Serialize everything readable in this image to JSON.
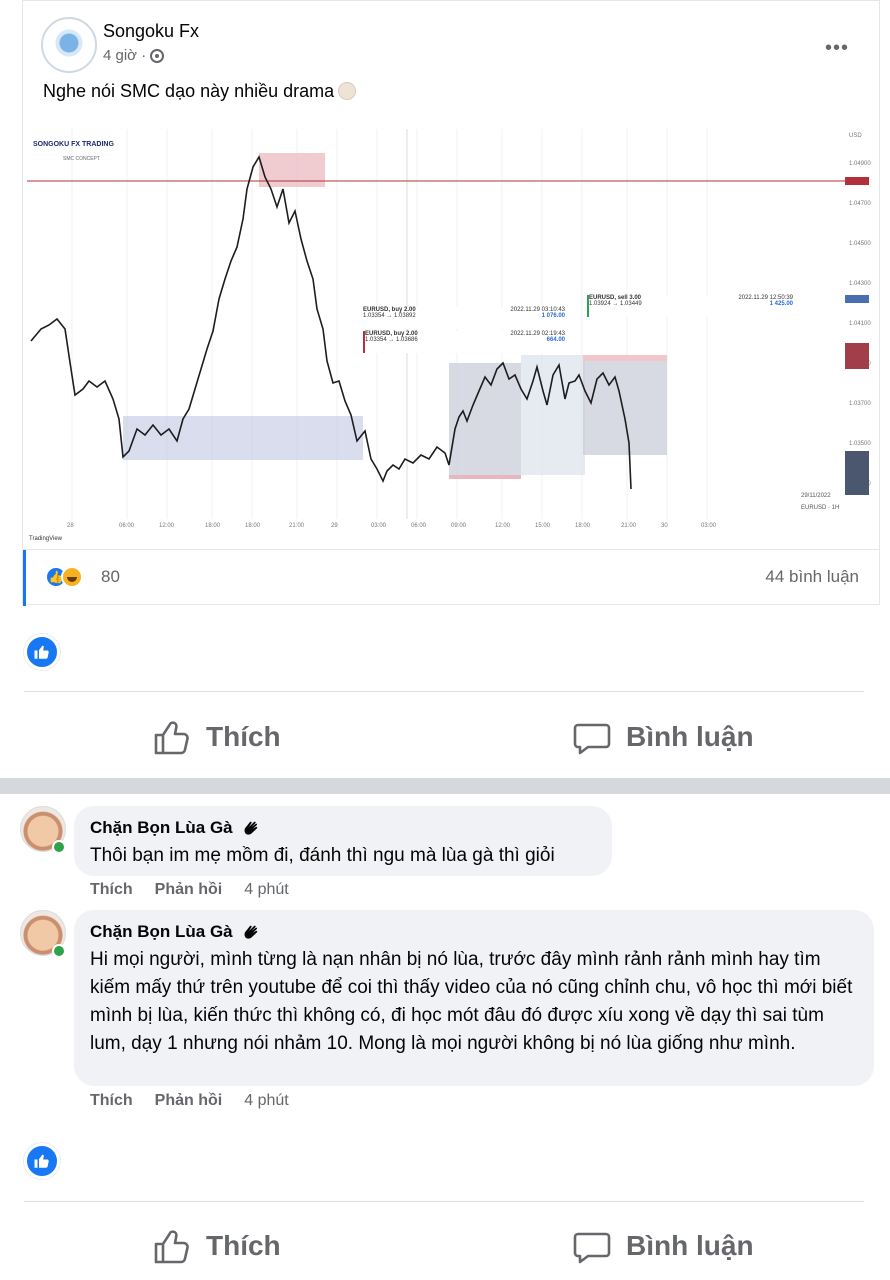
{
  "post": {
    "page_name": "Songoku Fx",
    "time": "4 giờ ·",
    "privacy_icon": "globe-icon",
    "more_label": "•••",
    "text": "Nghe nói SMC dạo này nhiều drama",
    "chart": {
      "brand": "SONGOKU FX TRADING",
      "subtitle": "SMC CONCEPT",
      "footer_tag": "TradingView",
      "symbol_label": "EURUSD · 1H",
      "date_label": "29/11/2022",
      "trade_boxes": [
        {
          "title": "EURUSD, buy 2.00",
          "prices": "1.03354 → 1.03892",
          "time": "2022.11.29 03:10:43",
          "profit": "1 076.00"
        },
        {
          "title": "EURUSD, buy 2.00",
          "prices": "1.03354 → 1.03686",
          "time": "2022.11.29 02:19:43",
          "profit": "664.00"
        },
        {
          "title": "EURUSD, sell 3.00",
          "prices": "1.03924 → 1.03449",
          "time": "2022.11.29 12:50:39",
          "profit": "1 425.00"
        }
      ]
    },
    "reactions": {
      "count": "80",
      "comments": "44 bình luận"
    }
  },
  "actions": {
    "like": "Thích",
    "comment": "Bình luận"
  },
  "comments": [
    {
      "name": "Chặn Bọn Lùa Gà",
      "text": "Thôi bạn im mẹ mồm đi, đánh thì ngu mà lùa gà thì giỏi",
      "like": "Thích",
      "reply": "Phản hồi",
      "time": "4 phút"
    },
    {
      "name": "Chặn Bọn Lùa Gà",
      "text": "Hi mọi người, mình từng là nạn nhân bị nó lùa, trước đây mình rảnh rảnh mình hay tìm kiếm mấy thứ trên youtube để coi thì thấy video của nó cũng chỉnh chu, vô học thì mới biết mình bị lùa, kiến thức thì không có, đi học mót đâu đó được xíu xong về dạy thì sai tùm lum, dạy 1 nhưng nói nhảm 10. Mong là mọi người không bị nó lùa giống như mình.",
      "like": "Thích",
      "reply": "Phản hồi",
      "time": "4 phút"
    }
  ],
  "colors": {
    "accent": "#1877f2",
    "muted": "#65676b",
    "bubble": "#f0f2f5",
    "online": "#31a24c"
  }
}
